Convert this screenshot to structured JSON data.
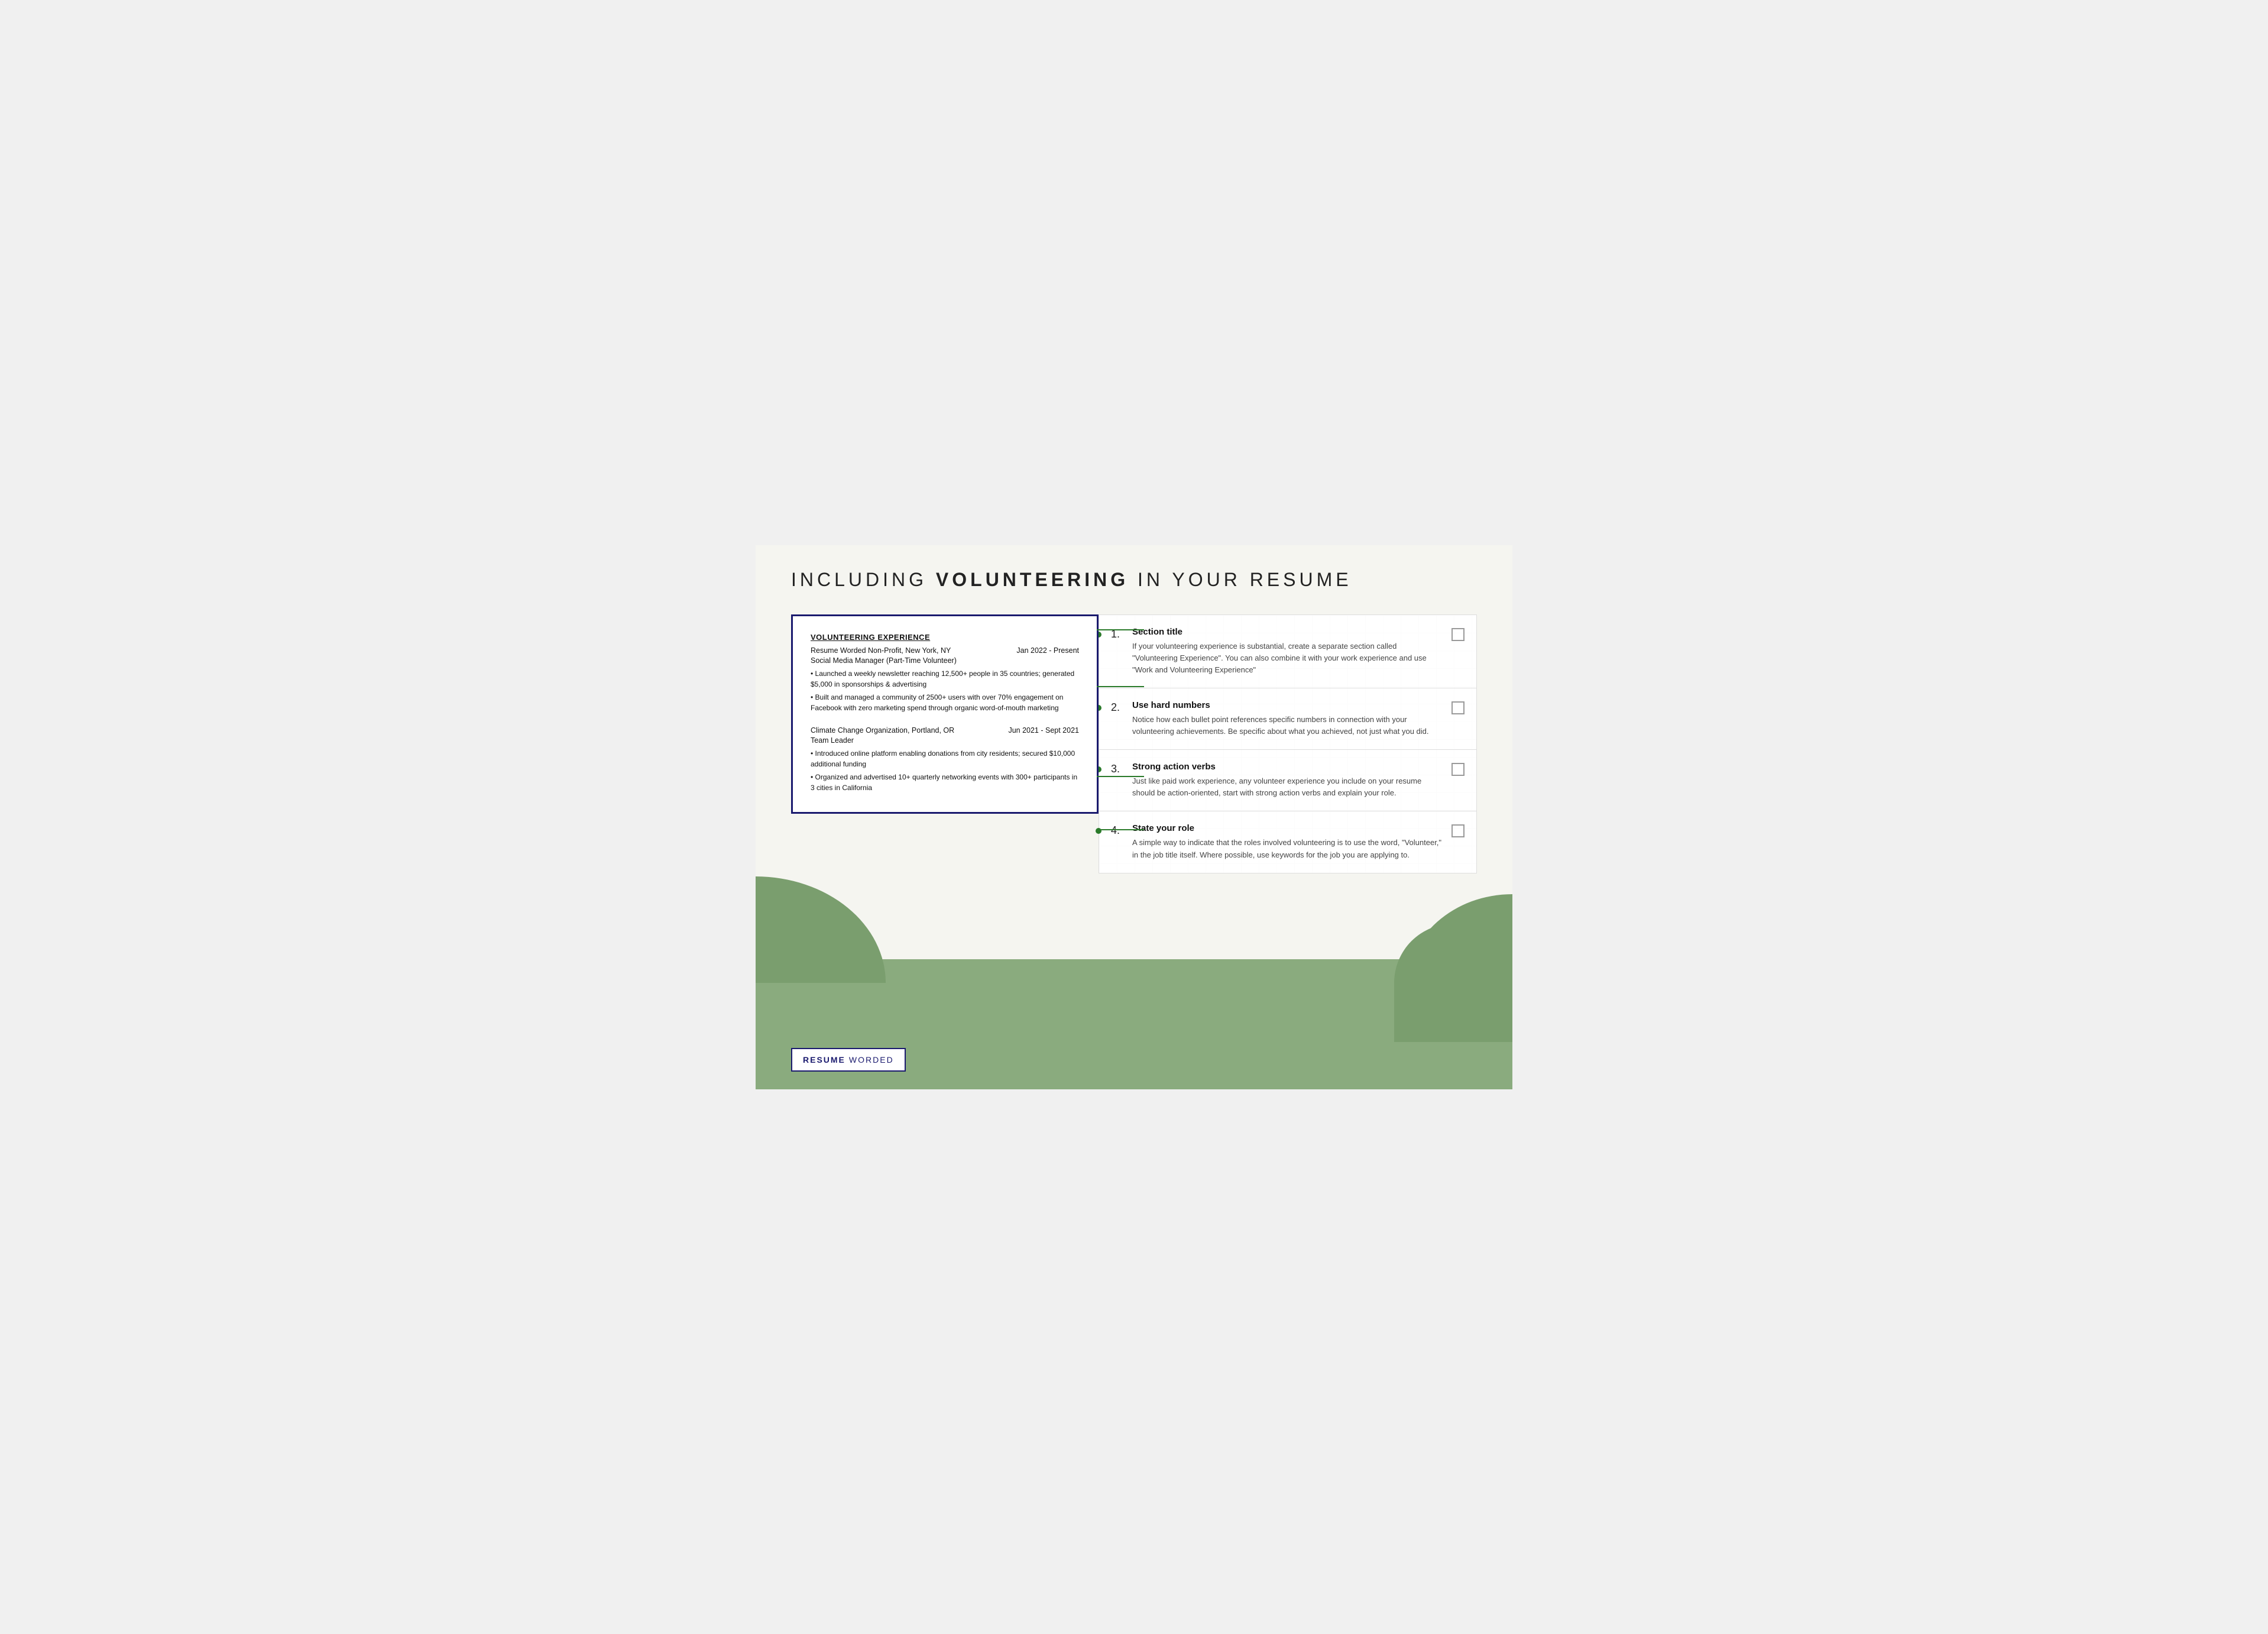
{
  "page": {
    "background_color": "#f5f5f0",
    "green_accent": "#8aab7e"
  },
  "header": {
    "title_prefix": "INCLUDING ",
    "title_bold": "VOLUNTEERING",
    "title_suffix": " IN YOUR RESUME"
  },
  "resume": {
    "section_title": "VOLUNTEERING EXPERIENCE",
    "entry1": {
      "org": "Resume Worded Non-Profit, New York, NY",
      "date": "Jan 2022 - Present",
      "role": "Social Media Manager (Part-Time Volunteer)",
      "bullet1": "• Launched a weekly newsletter reaching 12,500+ people in 35 countries; generated $5,000 in sponsorships & advertising",
      "bullet2": "• Built and managed a community of 2500+ users with over 70% engagement on Facebook with zero marketing spend through organic word-of-mouth marketing"
    },
    "entry2": {
      "org": "Climate Change Organization, Portland, OR",
      "date": "Jun 2021 - Sept 2021",
      "role": "Team Leader",
      "bullet1": "• Introduced online platform enabling donations from city residents; secured $10,000 additional funding",
      "bullet2": "• Organized and advertised 10+ quarterly networking events with 300+ participants in 3 cities in California"
    }
  },
  "tips": [
    {
      "number": "1.",
      "title": "Section title",
      "text": "If your volunteering experience is substantial, create a separate section called \"Volunteering Experience\". You can also combine it with your work experience and use \"Work and Volunteering Experience\""
    },
    {
      "number": "2.",
      "title": "Use hard numbers",
      "text": "Notice how each bullet point references specific numbers in connection with your volunteering achievements. Be specific about what you achieved, not just what you did."
    },
    {
      "number": "3.",
      "title": "Strong action verbs",
      "text": "Just like paid work experience, any volunteer experience you include on your resume should be action-oriented, start with strong action verbs and explain your role."
    },
    {
      "number": "4.",
      "title": "State your role",
      "text": "A simple way to indicate that the roles involved volunteering is to use the word, \"Volunteer,\" in the job title itself. Where possible, use keywords for the job you are applying to."
    }
  ],
  "logo": {
    "resume": "RESUME",
    "worded": "WORDED"
  }
}
